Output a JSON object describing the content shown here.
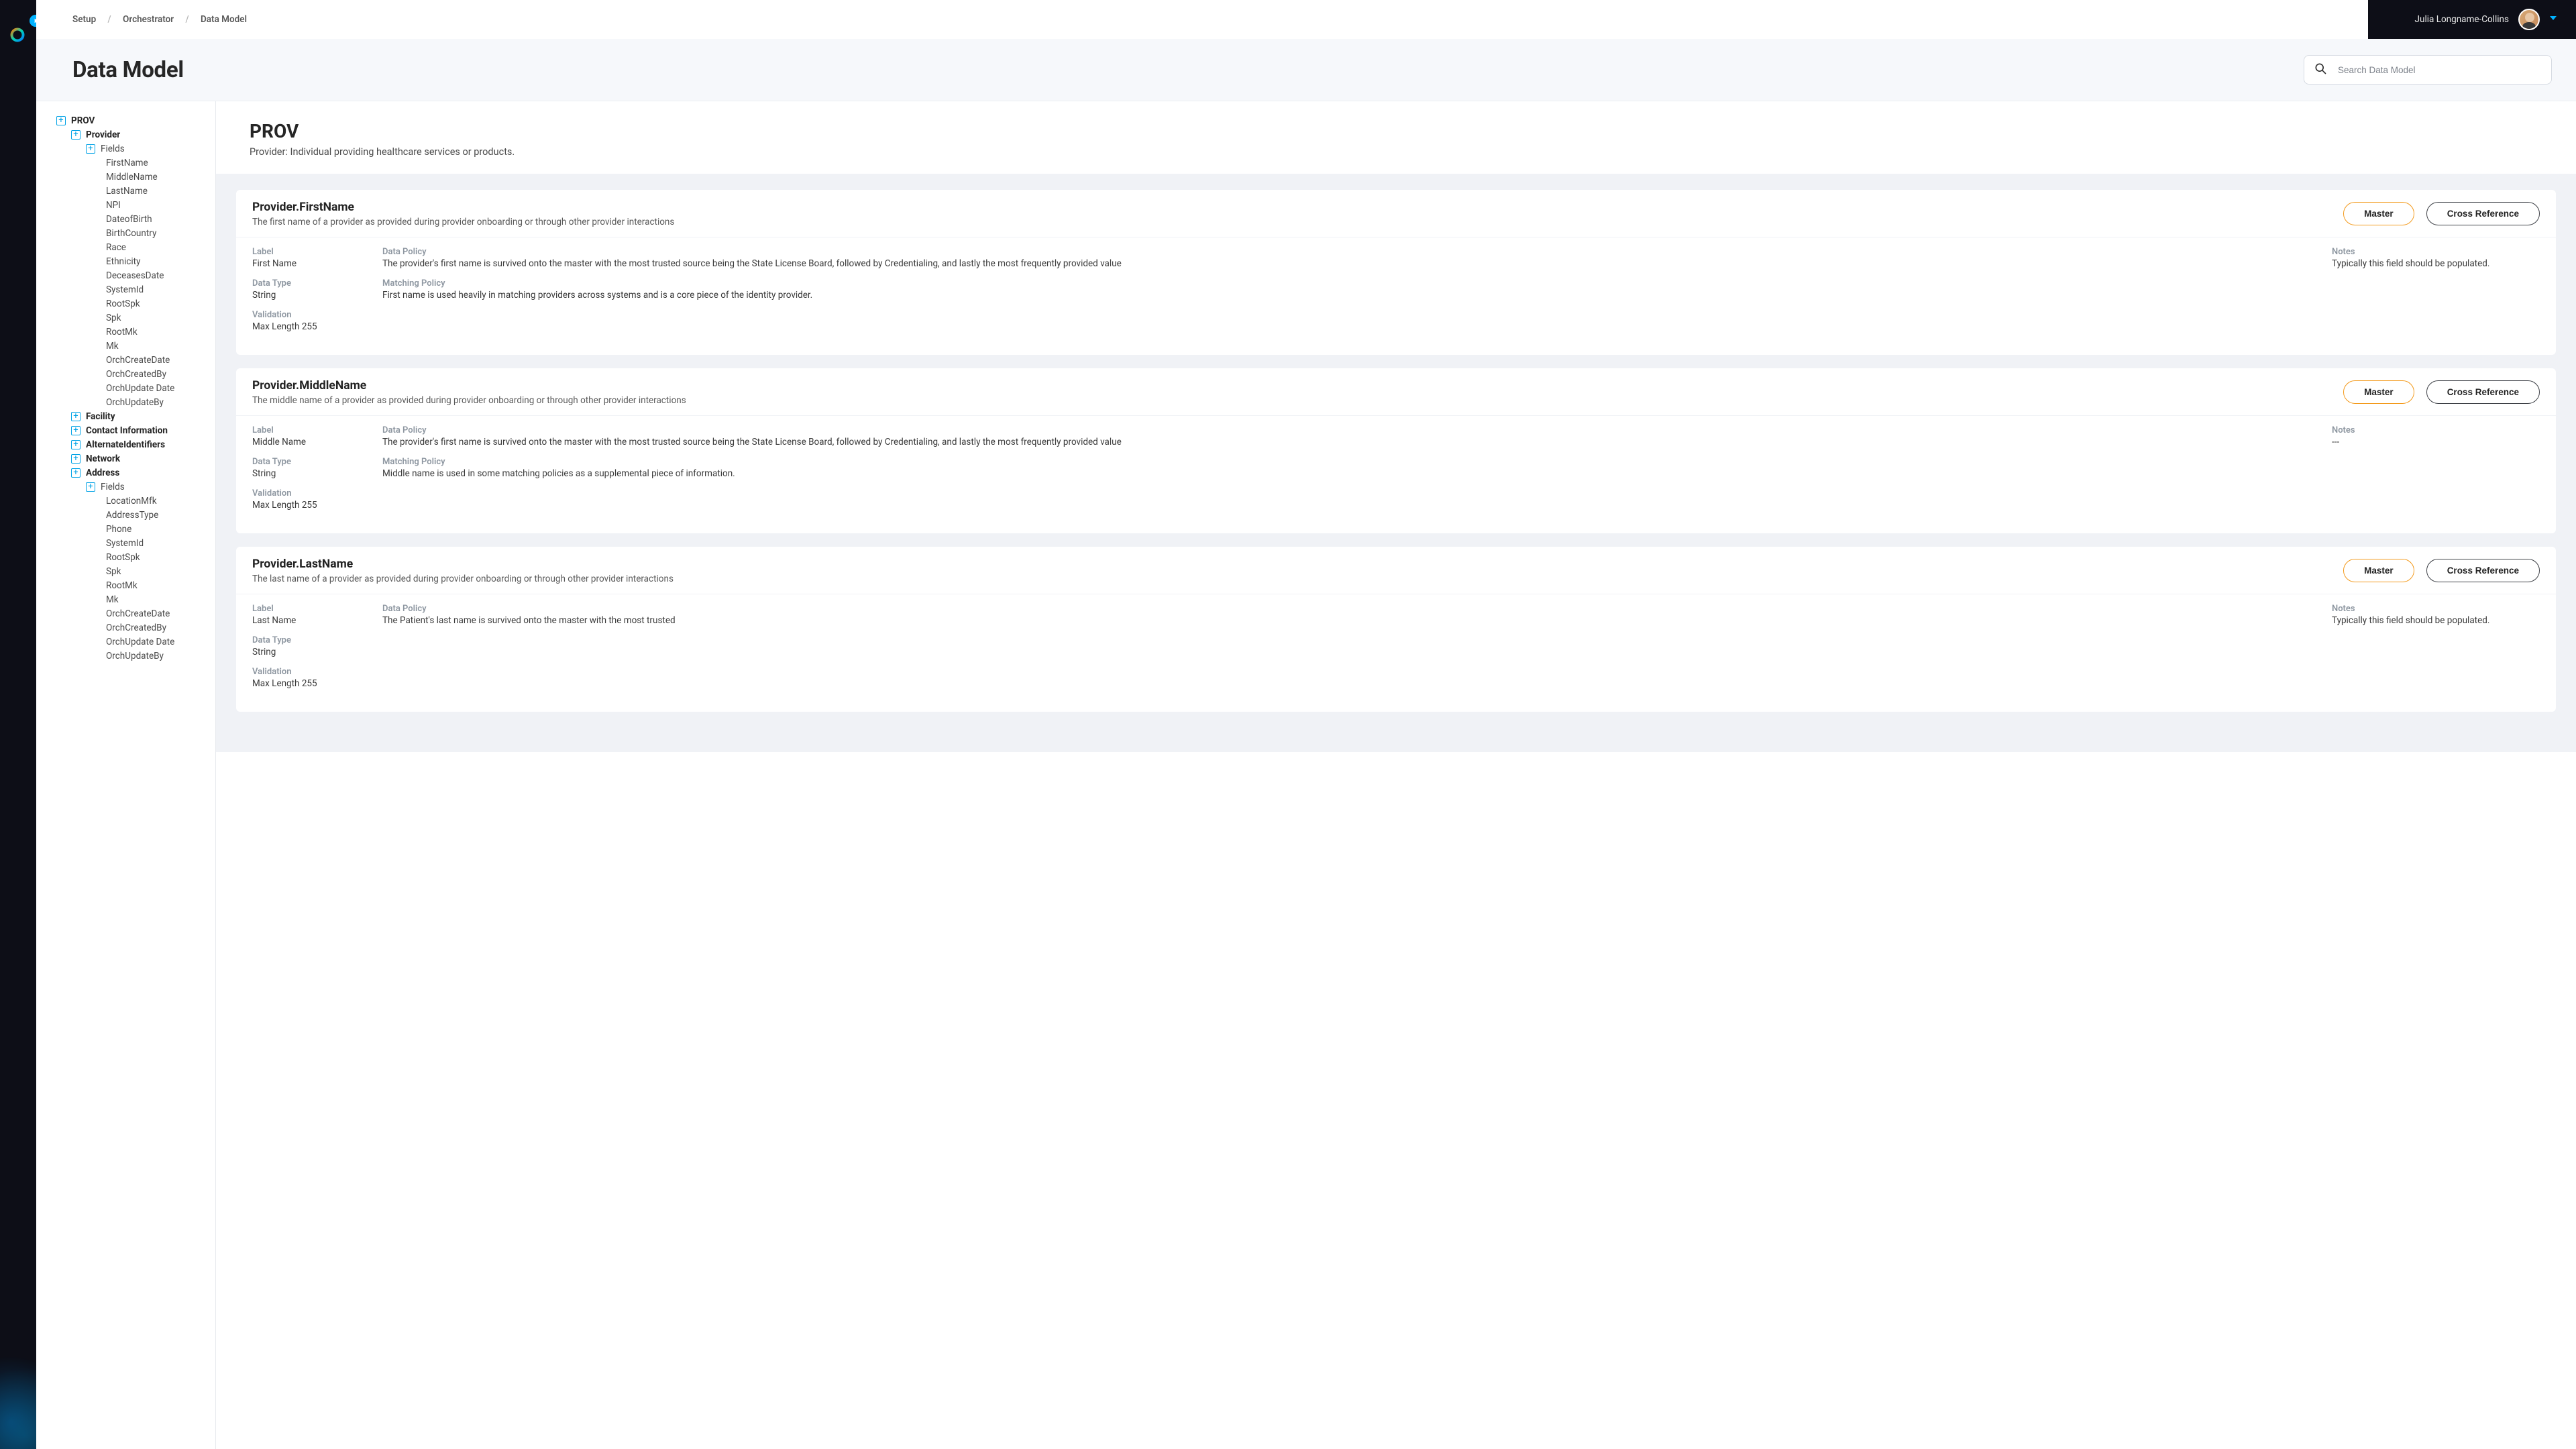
{
  "breadcrumb": [
    "Setup",
    "Orchestrator",
    "Data Model"
  ],
  "user": {
    "name": "Julia Longname-Collins"
  },
  "page": {
    "title": "Data Model"
  },
  "search": {
    "placeholder": "Search Data Model"
  },
  "tree": {
    "root": {
      "label": "PROV",
      "children": [
        {
          "label": "Provider",
          "children": [
            {
              "label": "Fields",
              "children": [
                "FirstName",
                "MiddleName",
                "LastName",
                "NPI",
                "DateofBirth",
                "BirthCountry",
                "Race",
                "Ethnicity",
                "DeceasesDate",
                "SystemId",
                "RootSpk",
                "Spk",
                "RootMk",
                "Mk",
                "OrchCreateDate",
                "OrchCreatedBy",
                "OrchUpdate Date",
                "OrchUpdateBy"
              ]
            }
          ]
        },
        {
          "label": "Facility"
        },
        {
          "label": "Contact Information"
        },
        {
          "label": "AlternateIdentifiers"
        },
        {
          "label": "Network"
        },
        {
          "label": "Address",
          "children": [
            {
              "label": "Fields",
              "children": [
                "LocationMfk",
                "AddressType",
                "Phone",
                "SystemId",
                "RootSpk",
                "Spk",
                "RootMk",
                "Mk",
                "OrchCreateDate",
                "OrchCreatedBy",
                "OrchUpdate Date",
                "OrchUpdateBy"
              ]
            }
          ]
        }
      ]
    }
  },
  "entity": {
    "name": "PROV",
    "description": "Provider: Individual providing healthcare services or products."
  },
  "labels": {
    "label": "Label",
    "datatype": "Data Type",
    "validation": "Validation",
    "datapolicy": "Data Policy",
    "matchingpolicy": "Matching Policy",
    "notes": "Notes",
    "master": "Master",
    "xref": "Cross Reference"
  },
  "attributes": [
    {
      "title": "Provider.FirstName",
      "subtitle": "The first name of a provider as provided during provider onboarding or through other provider interactions",
      "label": "First Name",
      "datatype": "String",
      "validation": "Max Length 255",
      "datapolicy": "The provider's  first name is survived onto the master with the most trusted source being the State License Board, followed by Credentialing, and lastly the most frequently provided value",
      "matchingpolicy": "First name is used heavily in matching providers across systems and is a core piece of the identity provider.",
      "notes": "Typically this field should be populated."
    },
    {
      "title": "Provider.MiddleName",
      "subtitle": "The middle name of a provider as provided during provider onboarding or through other provider interactions",
      "label": "Middle Name",
      "datatype": "String",
      "validation": "Max Length 255",
      "datapolicy": "The provider's  first name is survived onto the master with the most trusted source being the State License Board,  followed by Credentialing, and lastly the most frequently provided value",
      "matchingpolicy": "Middle name is used in some matching policies as a supplemental piece of information.",
      "notes": "---"
    },
    {
      "title": "Provider.LastName",
      "subtitle": "The last name of a provider as provided during provider onboarding or through other provider interactions",
      "label": "Last Name",
      "datatype": "String",
      "validation": "Max Length 255",
      "datapolicy": "The Patient's last name is survived onto the master with the most trusted",
      "matchingpolicy": "",
      "notes": "Typically this field should be populated."
    }
  ]
}
